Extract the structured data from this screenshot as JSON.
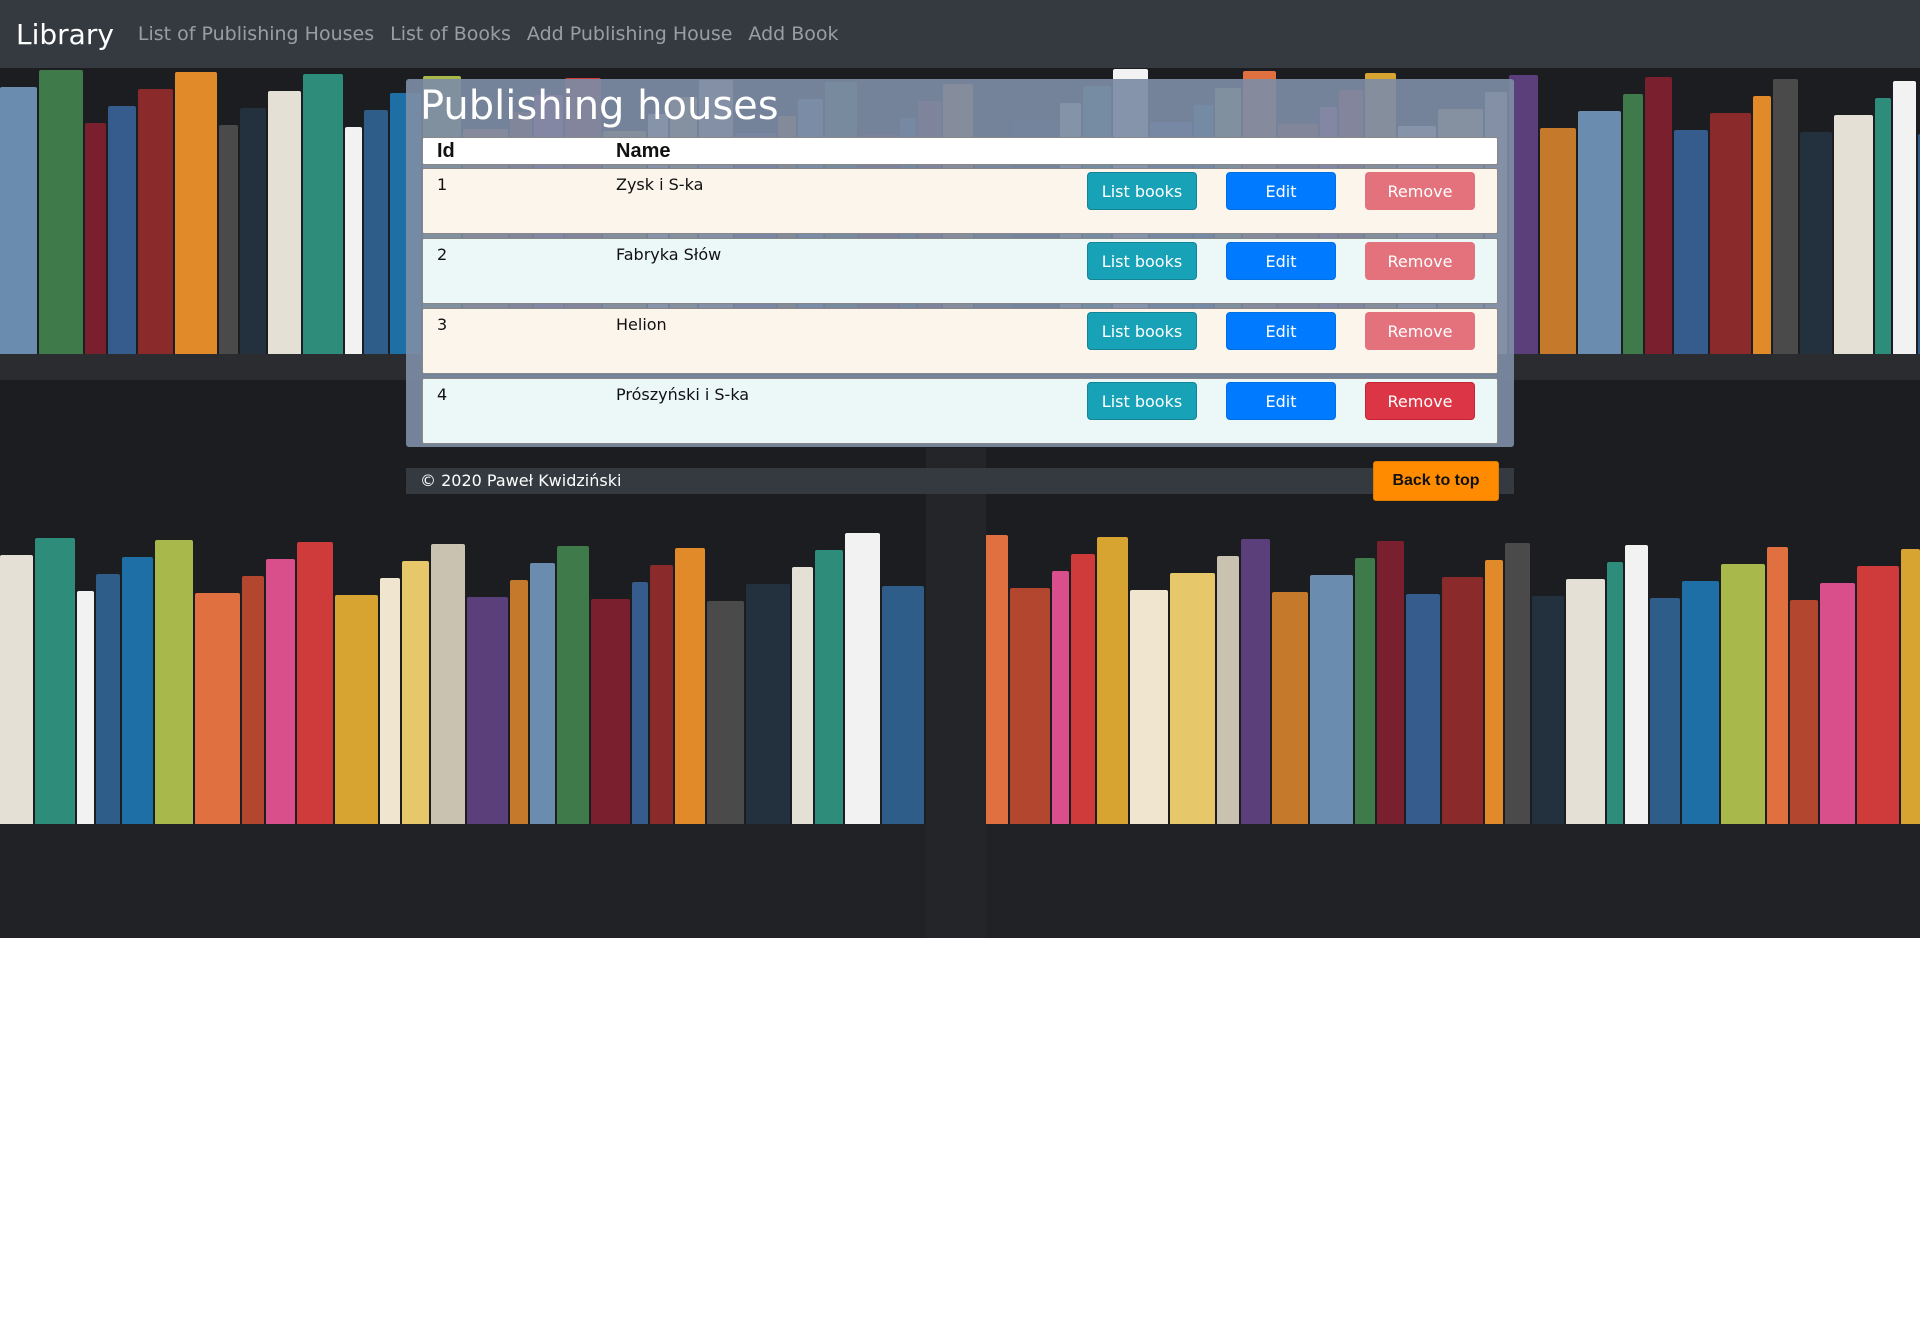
{
  "navbar": {
    "brand": "Library",
    "links": [
      "List of Publishing Houses",
      "List of Books",
      "Add Publishing House",
      "Add Book"
    ]
  },
  "page": {
    "title": "Publishing houses",
    "columns": [
      "Id",
      "Name"
    ],
    "rows": [
      {
        "id": "1",
        "name": "Zysk i S-ka"
      },
      {
        "id": "2",
        "name": "Fabryka Słów"
      },
      {
        "id": "3",
        "name": "Helion"
      },
      {
        "id": "4",
        "name": "Prószyński i S-ka"
      }
    ],
    "buttons": {
      "list": "List books",
      "edit": "Edit",
      "remove": "Remove"
    }
  },
  "footer": {
    "copyright": "© 2020 Paweł Kwidziński",
    "back_to_top": "Back to top"
  },
  "colors": {
    "navbar": "#343a40",
    "list_button": "#17a2b8",
    "edit_button": "#007bff",
    "remove_button": "#dc3545",
    "back_to_top": "#ff8c00"
  }
}
